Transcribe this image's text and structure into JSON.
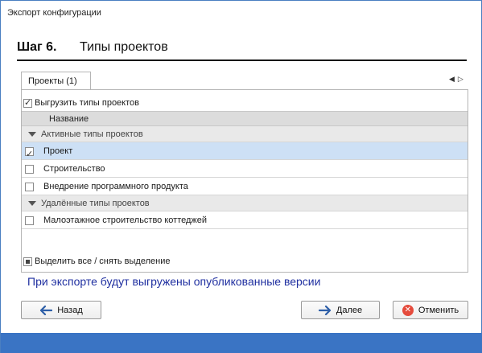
{
  "window": {
    "title": "Экспорт конфигурации"
  },
  "step": {
    "number": "Шаг 6.",
    "title": "Типы проектов"
  },
  "tabs": [
    {
      "label": "Проекты (1)"
    }
  ],
  "panel": {
    "export_toggle_label": "Выгрузить типы проектов",
    "export_toggle_checked": true,
    "column_header": "Название",
    "groups": [
      {
        "label": "Активные типы проектов",
        "rows": [
          {
            "label": "Проект",
            "checked": true,
            "selected": true
          },
          {
            "label": "Строительство",
            "checked": false,
            "selected": false
          },
          {
            "label": "Внедрение программного продукта",
            "checked": false,
            "selected": false
          }
        ]
      },
      {
        "label": "Удалённые типы проектов",
        "rows": [
          {
            "label": "Малоэтажное строительство коттеджей",
            "checked": false,
            "selected": false
          }
        ]
      }
    ],
    "select_all_label": "Выделить все / снять выделение"
  },
  "info_text": "При экспорте будут выгружены опубликованные версии",
  "buttons": {
    "back": "Назад",
    "next": "Далее",
    "cancel": "Отменить"
  },
  "colors": {
    "accent": "#3a74c4",
    "info_text": "#1f2fa0",
    "selection": "#cde0f5",
    "cancel": "#e54b3c",
    "arrow": "#2e5fa8"
  }
}
